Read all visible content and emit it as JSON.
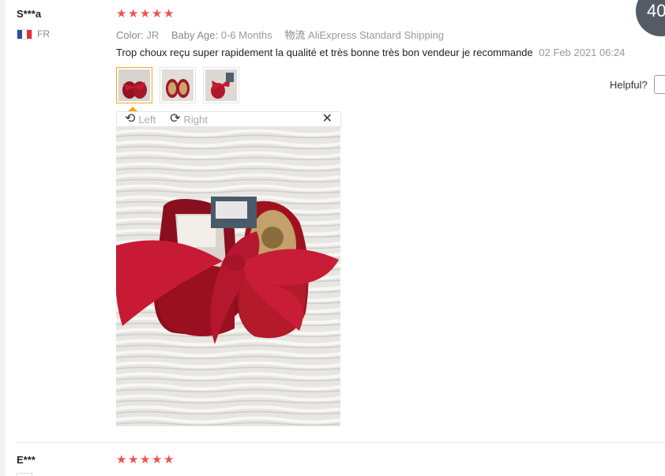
{
  "colors": {
    "star": "#f0504f",
    "accent_border": "#f5a623",
    "meta": "#999999"
  },
  "page_badge": "40",
  "reviews": [
    {
      "user": "S***a",
      "country": "FR",
      "stars": 5,
      "color_label": "Color:",
      "color_value": "JR",
      "size_label": "Baby Age:",
      "size_value": "0-6 Months",
      "shipping_label": "物流",
      "shipping_value": "AliExpress Standard Shipping",
      "text": "Trop choux reçu super rapidement la qualité et très bonne très bon vendeur je recommande",
      "date": "02 Feb 2021 06:24",
      "helpful_label": "Helpful?",
      "photos": [
        "shoe-photo-1",
        "shoe-photo-2",
        "shoe-photo-3"
      ],
      "viewer": {
        "left_label": "Left",
        "right_label": "Right",
        "close_icon": "close-icon",
        "rotate_left_icon": "rotate-left-icon",
        "rotate_right_icon": "rotate-right-icon"
      }
    },
    {
      "user": "E***",
      "stars": 5
    }
  ]
}
